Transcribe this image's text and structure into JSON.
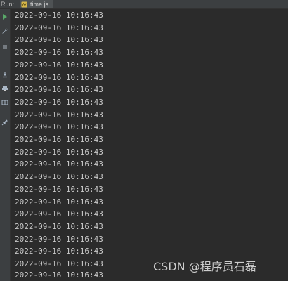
{
  "top_bar": {
    "run_label": "Run:",
    "tab_label": "time.js"
  },
  "console": {
    "lines": [
      "2022-09-16 10:16:43",
      "2022-09-16 10:16:43",
      "2022-09-16 10:16:43",
      "2022-09-16 10:16:43",
      "2022-09-16 10:16:43",
      "2022-09-16 10:16:43",
      "2022-09-16 10:16:43",
      "2022-09-16 10:16:43",
      "2022-09-16 10:16:43",
      "2022-09-16 10:16:43",
      "2022-09-16 10:16:43",
      "2022-09-16 10:16:43",
      "2022-09-16 10:16:43",
      "2022-09-16 10:16:43",
      "2022-09-16 10:16:43",
      "2022-09-16 10:16:43",
      "2022-09-16 10:16:43",
      "2022-09-16 10:16:43",
      "2022-09-16 10:16:43",
      "2022-09-16 10:16:43",
      "2022-09-16 10:16:43",
      "2022-09-16 10:16:43"
    ]
  },
  "watermark": {
    "text": "CSDN @程序员石磊"
  },
  "toolbar_icons": [
    "run-icon",
    "wrench-icon",
    "stop-icon",
    "download-icon",
    "print-icon",
    "layout-icon",
    "pin-icon"
  ],
  "colors": {
    "background": "#2b2b2b",
    "panel": "#3c3f41",
    "text": "#c8c8c8",
    "run_green": "#59a869"
  }
}
